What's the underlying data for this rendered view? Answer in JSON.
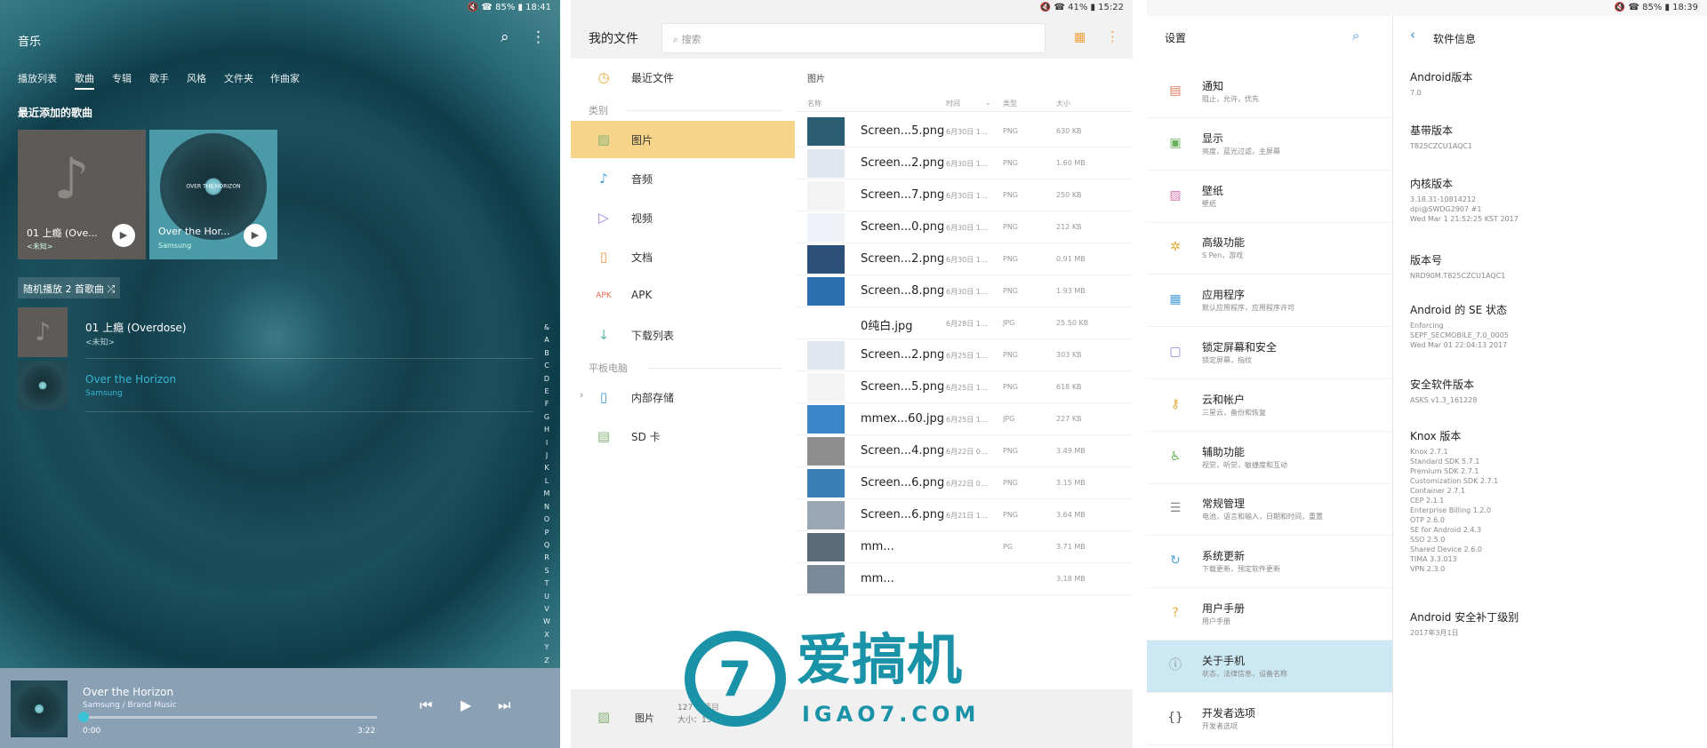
{
  "music": {
    "status": "🔇 ☎ 85% ▮ 18:41",
    "title": "音乐",
    "tabs": [
      "播放列表",
      "歌曲",
      "专辑",
      "歌手",
      "风格",
      "文件夹",
      "作曲家"
    ],
    "active_tab": 1,
    "section": "最近添加的歌曲",
    "cards": [
      {
        "title": "01 上瘾 (Ove...",
        "subtitle": "<未知>"
      },
      {
        "title": "Over the Hor...",
        "subtitle": "Samsung",
        "disc_label": "OVER THE HORIZON"
      }
    ],
    "shuffle": "随机播放 2 首歌曲 ⤮",
    "songs": [
      {
        "title": "01 上瘾 (Overdose)",
        "artist": "<未知>"
      },
      {
        "title": "Over the Horizon",
        "artist": "Samsung",
        "highlight": "#37b8d4"
      }
    ],
    "alpha": [
      "&",
      "A",
      "B",
      "C",
      "D",
      "E",
      "F",
      "G",
      "H",
      "I",
      "J",
      "K",
      "L",
      "M",
      "N",
      "O",
      "P",
      "Q",
      "R",
      "S",
      "T",
      "U",
      "V",
      "W",
      "X",
      "Y",
      "Z",
      "#"
    ],
    "player": {
      "title": "Over the Horizon",
      "artist": "Samsung / Brand Music",
      "elapsed": "0:00",
      "duration": "3:22"
    }
  },
  "files": {
    "status": "🔇 ☎ 41% ▮ 15:22",
    "title": "我的文件",
    "search_placeholder": "搜索",
    "sidebar": {
      "recent": "最近文件",
      "cat_header": "类别",
      "categories": [
        "图片",
        "音频",
        "视频",
        "文档",
        "APK",
        "下载列表"
      ],
      "selected": 0,
      "device_header": "平板电脑",
      "storage": [
        "内部存储",
        "SD 卡"
      ]
    },
    "main": {
      "caption": "图片",
      "headers": {
        "name": "名称",
        "time": "时间",
        "type": "类型",
        "size": "大小"
      },
      "rows": [
        {
          "name": "Screen...5.png",
          "date": "6月30日 1...",
          "type": "PNG",
          "size": "630 KB"
        },
        {
          "name": "Screen...2.png",
          "date": "6月30日 1...",
          "type": "PNG",
          "size": "1.60 MB"
        },
        {
          "name": "Screen...7.png",
          "date": "6月30日 1...",
          "type": "PNG",
          "size": "250 KB"
        },
        {
          "name": "Screen...0.png",
          "date": "6月30日 1...",
          "type": "PNG",
          "size": "212 KB"
        },
        {
          "name": "Screen...2.png",
          "date": "6月30日 1...",
          "type": "PNG",
          "size": "0.91 MB"
        },
        {
          "name": "Screen...8.png",
          "date": "6月30日 1...",
          "type": "PNG",
          "size": "1.93 MB"
        },
        {
          "name": "0纯白.jpg",
          "date": "6月28日 1...",
          "type": "JPG",
          "size": "25.50 KB"
        },
        {
          "name": "Screen...2.png",
          "date": "6月25日 1...",
          "type": "PNG",
          "size": "303 KB"
        },
        {
          "name": "Screen...5.png",
          "date": "6月25日 1...",
          "type": "PNG",
          "size": "618 KB"
        },
        {
          "name": "mmex...60.jpg",
          "date": "6月25日 1...",
          "type": "JPG",
          "size": "227 KB"
        },
        {
          "name": "Screen...4.png",
          "date": "6月22日 0...",
          "type": "PNG",
          "size": "3.49 MB"
        },
        {
          "name": "Screen...6.png",
          "date": "6月22日 0...",
          "type": "PNG",
          "size": "3.15 MB"
        },
        {
          "name": "Screen...6.png",
          "date": "6月21日 1...",
          "type": "PNG",
          "size": "3.64 MB"
        },
        {
          "name": "mm...",
          "date": "",
          "type": "PG",
          "size": "3.71 MB"
        },
        {
          "name": "mm...",
          "date": "",
          "type": "",
          "size": "3.18 MB"
        }
      ]
    },
    "footer": {
      "label": "图片",
      "count": "127 个项目",
      "size": "大小：158 MB"
    }
  },
  "watermark": {
    "logo": "7",
    "cn": "爱搞机",
    "en": "IGAO7.COM"
  },
  "settings": {
    "status": "🔇 ☎ 85% ▮ 18:39",
    "title": "设置",
    "items": [
      {
        "t": "通知",
        "s": "阻止，允许，优先",
        "icon": "▤"
      },
      {
        "t": "显示",
        "s": "亮度，蓝光过滤，主屏幕",
        "icon": "▣"
      },
      {
        "t": "壁纸",
        "s": "壁纸",
        "icon": "▨"
      },
      {
        "t": "高级功能",
        "s": "S Pen，游戏",
        "icon": "✲"
      },
      {
        "t": "应用程序",
        "s": "默认应用程序，应用程序许可",
        "icon": "▦"
      },
      {
        "t": "锁定屏幕和安全",
        "s": "锁定屏幕，指纹",
        "icon": "▢"
      },
      {
        "t": "云和帐户",
        "s": "三星云，备份和恢复",
        "icon": "⚷"
      },
      {
        "t": "辅助功能",
        "s": "视觉，听觉，敏捷度和互动",
        "icon": "♿"
      },
      {
        "t": "常规管理",
        "s": "电池，语言和输入，日期和时间，重置",
        "icon": "☰"
      },
      {
        "t": "系统更新",
        "s": "下载更新，预定软件更新",
        "icon": "↻"
      },
      {
        "t": "用户手册",
        "s": "用户手册",
        "icon": "?"
      },
      {
        "t": "关于手机",
        "s": "状态，法律信息，设备名称",
        "icon": "ⓘ"
      },
      {
        "t": "开发者选项",
        "s": "开发者选项",
        "icon": "{}"
      }
    ],
    "selected": 11,
    "detail_title": "软件信息",
    "info": [
      {
        "k": "Android版本",
        "v": [
          "7.0"
        ]
      },
      {
        "k": "基带版本",
        "v": [
          "T825CZCU1AQC1"
        ]
      },
      {
        "k": "内核版本",
        "v": [
          "3.18.31-10814212",
          "dpi@SWDG2907 #1",
          "Wed Mar 1 21:52:25 KST 2017"
        ]
      },
      {
        "k": "版本号",
        "v": [
          "NRD90M.T825CZCU1AQC1"
        ]
      },
      {
        "k": "Android 的 SE 状态",
        "v": [
          "Enforcing",
          "SEPF_SECMOBILE_7.0_0005",
          "Wed Mar 01 22:04:13 2017"
        ]
      },
      {
        "k": "安全软件版本",
        "v": [
          "ASKS v1.3_161228"
        ]
      },
      {
        "k": "Knox 版本",
        "v": [
          "Knox 2.7.1",
          "Standard SDK 5.7.1",
          "Premium SDK 2.7.1",
          "Customization SDK 2.7.1",
          "Container 2.7.1",
          "CEP 2.1.1",
          "Enterprise Billing 1.2.0",
          "OTP 2.6.0",
          "SE for Android 2.4.3",
          "SSO 2.5.0",
          "Shared Device 2.6.0",
          "TIMA 3.3.013",
          "VPN 2.3.0"
        ]
      },
      {
        "k": "Android 安全补丁级别",
        "v": [
          "2017年3月1日"
        ]
      }
    ]
  }
}
